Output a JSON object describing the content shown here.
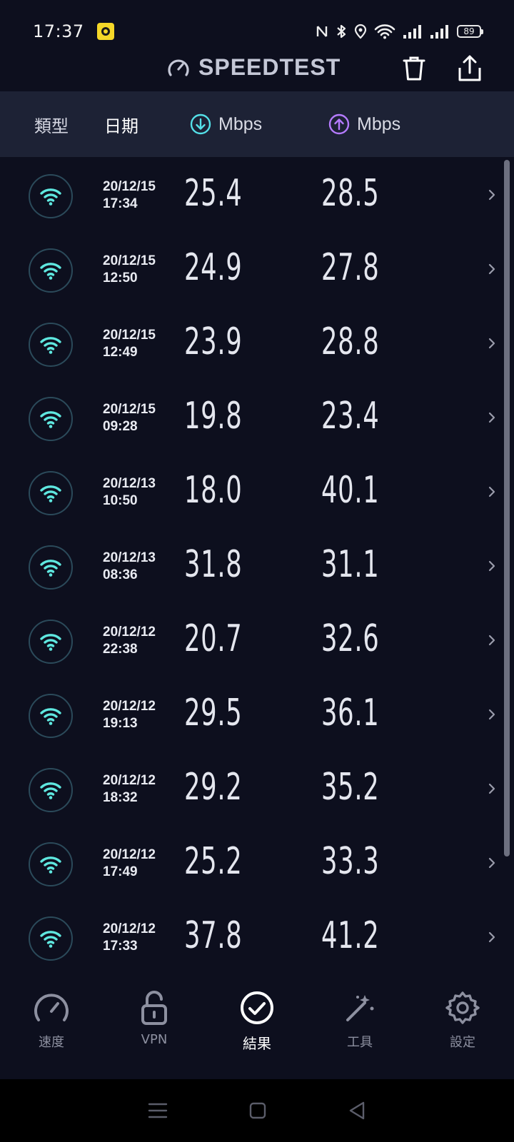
{
  "status_bar": {
    "time": "17:37",
    "battery": "89",
    "icons": [
      "nfc-icon",
      "bluetooth-icon",
      "location-icon",
      "wifi-icon",
      "signal-icon",
      "signal-icon",
      "battery-icon"
    ]
  },
  "header": {
    "brand": "SPEEDTEST",
    "brand_icon": "speedometer-icon",
    "actions": [
      "trash-icon",
      "share-icon"
    ]
  },
  "columns": {
    "type": "類型",
    "date": "日期",
    "download_unit": "Mbps",
    "upload_unit": "Mbps"
  },
  "colors": {
    "download": "#54e0e8",
    "upload": "#b57bff",
    "wifi": "#5fe8e0",
    "background": "#0d0f1e",
    "header_bar": "#1d2235"
  },
  "results": [
    {
      "date": "20/12/15",
      "time": "17:34",
      "download": "25.4",
      "upload": "28.5"
    },
    {
      "date": "20/12/15",
      "time": "12:50",
      "download": "24.9",
      "upload": "27.8"
    },
    {
      "date": "20/12/15",
      "time": "12:49",
      "download": "23.9",
      "upload": "28.8"
    },
    {
      "date": "20/12/15",
      "time": "09:28",
      "download": "19.8",
      "upload": "23.4"
    },
    {
      "date": "20/12/13",
      "time": "10:50",
      "download": "18.0",
      "upload": "40.1"
    },
    {
      "date": "20/12/13",
      "time": "08:36",
      "download": "31.8",
      "upload": "31.1"
    },
    {
      "date": "20/12/12",
      "time": "22:38",
      "download": "20.7",
      "upload": "32.6"
    },
    {
      "date": "20/12/12",
      "time": "19:13",
      "download": "29.5",
      "upload": "36.1"
    },
    {
      "date": "20/12/12",
      "time": "18:32",
      "download": "29.2",
      "upload": "35.2"
    },
    {
      "date": "20/12/12",
      "time": "17:49",
      "download": "25.2",
      "upload": "33.3"
    },
    {
      "date": "20/12/12",
      "time": "17:33",
      "download": "37.8",
      "upload": "41.2"
    }
  ],
  "nav": [
    {
      "label": "速度",
      "icon": "speedometer-icon",
      "active": false
    },
    {
      "label": "VPN",
      "icon": "lock-open-icon",
      "active": false
    },
    {
      "label": "結果",
      "icon": "check-circle-icon",
      "active": true
    },
    {
      "label": "工具",
      "icon": "magic-wand-icon",
      "active": false
    },
    {
      "label": "設定",
      "icon": "gear-icon",
      "active": false
    }
  ],
  "system_nav": [
    "menu-icon",
    "home-icon",
    "back-icon"
  ]
}
